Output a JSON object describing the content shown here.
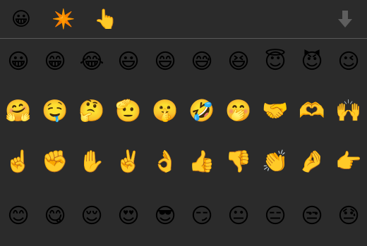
{
  "toolbar": {
    "categories": [
      {
        "name": "smileys",
        "glyph": "😀"
      },
      {
        "name": "symbols",
        "glyph": "✴️"
      },
      {
        "name": "gestures",
        "glyph": "👆"
      }
    ],
    "collapse_icon": "down-arrow-icon"
  },
  "colors": {
    "background": "#2b2b2b",
    "divider": "#5a5a5a",
    "collapse_arrow": "#5e5e5e"
  },
  "emoji_rows": [
    [
      "😀",
      "😁",
      "😂",
      "😃",
      "😄",
      "😅",
      "😆",
      "😇",
      "😈",
      "😉"
    ],
    [
      "🤗",
      "🤤",
      "🤔",
      "🫡",
      "🤫",
      "🤣",
      "🤭",
      "🤝",
      "🫶",
      "🙌"
    ],
    [
      "☝️",
      "✊",
      "✋",
      "✌️",
      "👌",
      "👍",
      "👎",
      "👏",
      "🤌",
      "👉"
    ],
    [
      "😊",
      "😋",
      "😌",
      "😍",
      "😎",
      "😏",
      "😐",
      "😑",
      "😒",
      "😓"
    ]
  ]
}
